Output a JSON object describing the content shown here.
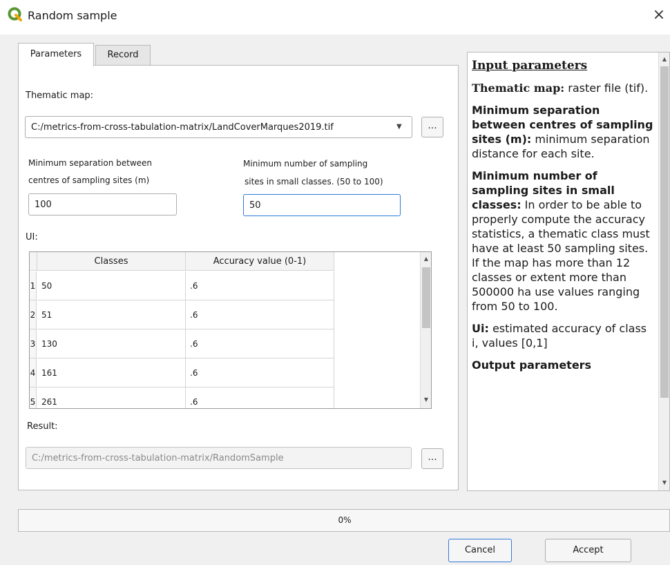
{
  "window": {
    "title": "Random sample",
    "close_symbol": "×",
    "icon": "qgis-logo-icon"
  },
  "tabs": [
    {
      "label": "Parameters",
      "active": true
    },
    {
      "label": "Record",
      "active": false
    }
  ],
  "form": {
    "thematic_map_label": "Thematic map:",
    "thematic_map_value": "C:/metrics-from-cross-tabulation-matrix/LandCoverMarques2019.tif",
    "browse_label": "...",
    "min_separation_label_line1": "Minimum separation between",
    "min_separation_label_line2": "centres of sampling sites (m)",
    "min_separation_value": "100",
    "min_sites_label_line1": "Minimum number of sampling",
    "min_sites_label_line2": "sites in small classes. (50 to 100)",
    "min_sites_value": "50",
    "ui_label": "UI:",
    "result_label": "Result:",
    "result_value": "C:/metrics-from-cross-tabulation-matrix/RandomSample"
  },
  "table": {
    "columns": [
      "Classes",
      "Accuracy value (0-1)"
    ],
    "rows": [
      {
        "num": "1",
        "class": "50",
        "accuracy": ".6"
      },
      {
        "num": "2",
        "class": "51",
        "accuracy": ".6"
      },
      {
        "num": "3",
        "class": "130",
        "accuracy": ".6"
      },
      {
        "num": "4",
        "class": "161",
        "accuracy": ".6"
      },
      {
        "num": "5",
        "class": "261",
        "accuracy": ".6"
      }
    ]
  },
  "help": {
    "heading": "Input parameters",
    "thematic_map_term": "Thematic map:",
    "thematic_map_desc": " raster file (tif).",
    "min_sep_term": "Minimum separation between centres of sampling sites (m):",
    "min_sep_desc": " minimum separation distance for each site.",
    "min_num_term": "Minimum number of sampling sites in small classes:",
    "min_num_desc": " In order to be able to properly compute the accuracy statistics, a thematic class must have at least 50 sampling sites. If the map has more than 12 classes or extent more than 500000 ha use values ranging from 50 to 100.",
    "ui_term": "Ui:",
    "ui_desc": " estimated accuracy of class i, values [0,1]",
    "output_term": "Output parameters"
  },
  "progress": {
    "text": "0%",
    "value_percent": 0
  },
  "buttons": {
    "cancel": "Cancel",
    "accept": "Accept"
  },
  "colors": {
    "accent": "#2f7ad8",
    "qgis_green": "#589632",
    "qgis_yellow": "#ee7913"
  }
}
